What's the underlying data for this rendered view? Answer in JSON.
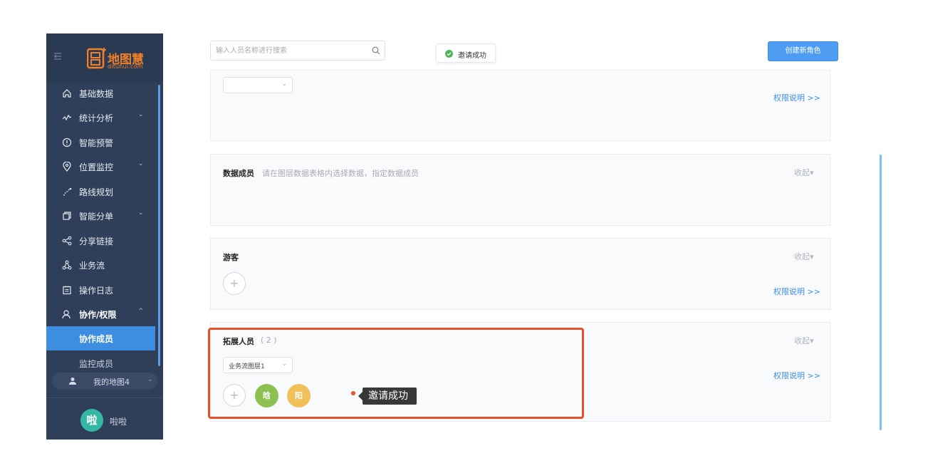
{
  "app": {
    "logo_text": "地图慧",
    "logo_sub": "dituhui.com"
  },
  "sidebar": {
    "items": [
      {
        "label": "基础数据",
        "icon": "home-icon"
      },
      {
        "label": "统计分析",
        "icon": "line-chart-icon",
        "chevron": "⌄"
      },
      {
        "label": "智能预警",
        "icon": "alert-circle-icon"
      },
      {
        "label": "位置监控",
        "icon": "location-pin-icon",
        "chevron": "⌄"
      },
      {
        "label": "路线规划",
        "icon": "route-icon"
      },
      {
        "label": "智能分单",
        "icon": "split-order-icon",
        "chevron": "⌄"
      },
      {
        "label": "分享链接",
        "icon": "share-icon"
      },
      {
        "label": "业务流",
        "icon": "workflow-icon"
      },
      {
        "label": "操作日志",
        "icon": "clipboard-icon"
      },
      {
        "label": "协作/权限",
        "icon": "user-icon",
        "chevron": "^"
      }
    ],
    "sub_items": [
      {
        "label": "协作成员",
        "active": true
      },
      {
        "label": "监控成员",
        "active": false
      }
    ],
    "my_map": {
      "label": "我的地图4",
      "chevron": "⌄"
    },
    "user": {
      "avatar": "啦",
      "name": "啦啦"
    }
  },
  "toolbar": {
    "search_placeholder": "输入人员名称进行搜索",
    "create_role": "创建新角色"
  },
  "toast": {
    "message": "邀请成功"
  },
  "cards": {
    "top": {
      "permission": "权限说明 >>"
    },
    "data_members": {
      "title": "数据成员",
      "hint": "请在图层数据表格内选择数据，指定数据成员",
      "collapse": "收起▾"
    },
    "guests": {
      "title": "游客",
      "collapse": "收起▾",
      "add": "+",
      "permission": "权限说明 >>"
    },
    "extended": {
      "title": "拓展人员",
      "count": "( 2 )",
      "collapse": "收起▾",
      "select_value": "业务流图层1",
      "add": "+",
      "members": [
        {
          "label": "晗",
          "color": "#8cc152"
        },
        {
          "label": "阳",
          "color": "#f0c05a"
        }
      ],
      "permission": "权限说明 >>"
    }
  },
  "annotation": {
    "callout": "邀请成功",
    "color": "#e9502a"
  }
}
